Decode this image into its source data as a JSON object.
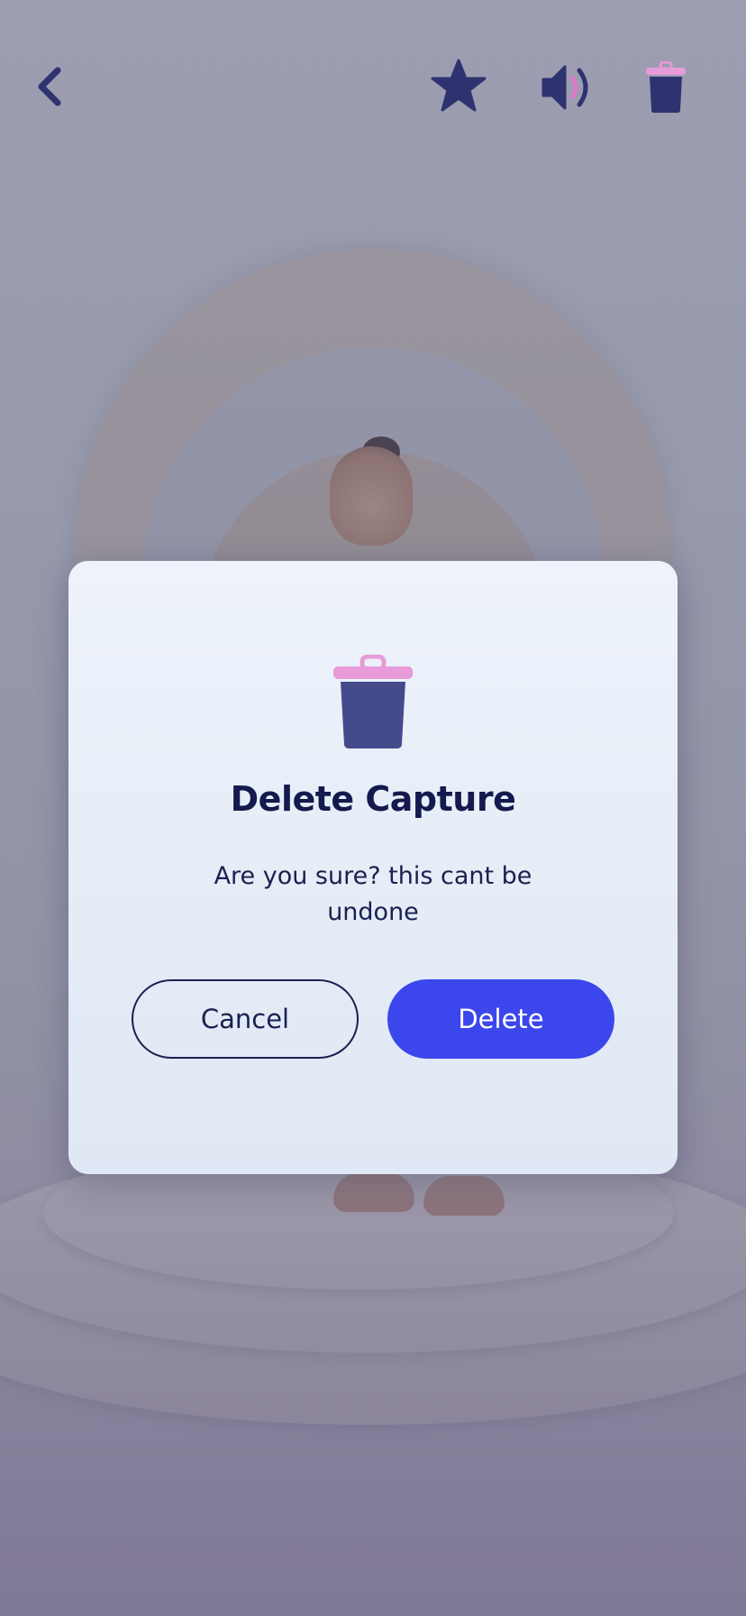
{
  "top_bar": {
    "back_icon": "chevron-left-icon",
    "favorite_icon": "star-icon",
    "sound_icon": "speaker-icon",
    "delete_icon": "trash-icon"
  },
  "dialog": {
    "icon": "trash-icon",
    "title": "Delete Capture",
    "message": "Are you sure? this cant be undone",
    "cancel_label": "Cancel",
    "delete_label": "Delete"
  },
  "colors": {
    "icon_navy": "#2e3370",
    "trash_lid_pink": "#e79bd8",
    "trash_body": "#444a8c",
    "title_text": "#141a4d",
    "delete_button": "#3b47ec",
    "sound_wave_pink": "#d97bc8"
  }
}
